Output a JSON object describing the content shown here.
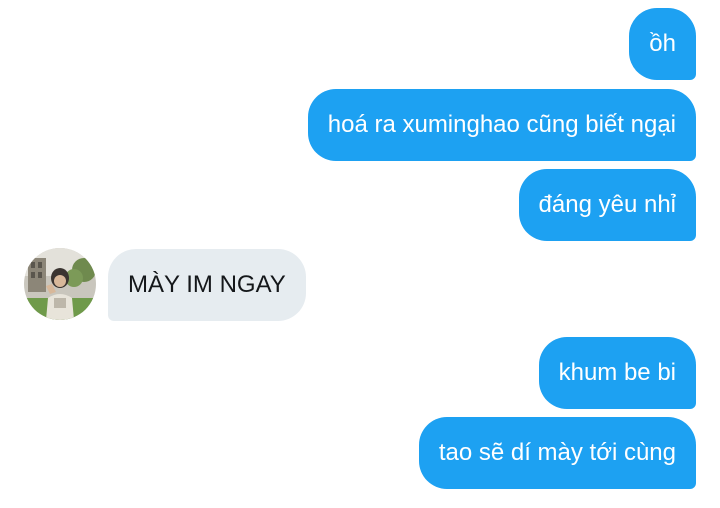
{
  "messages": [
    {
      "direction": "outgoing",
      "text": "ồh"
    },
    {
      "direction": "outgoing",
      "text": "hoá ra xuminghao cũng biết ngại"
    },
    {
      "direction": "outgoing",
      "text": "đáng yêu nhỉ"
    },
    {
      "direction": "incoming",
      "text": "MÀY IM NGAY"
    },
    {
      "direction": "outgoing",
      "text": "khum be bi"
    },
    {
      "direction": "outgoing",
      "text": "tao sẽ dí mày tới cùng"
    }
  ],
  "colors": {
    "outgoing_bubble": "#1da1f2",
    "outgoing_text": "#ffffff",
    "incoming_bubble": "#e6ecf0",
    "incoming_text": "#14171a"
  }
}
